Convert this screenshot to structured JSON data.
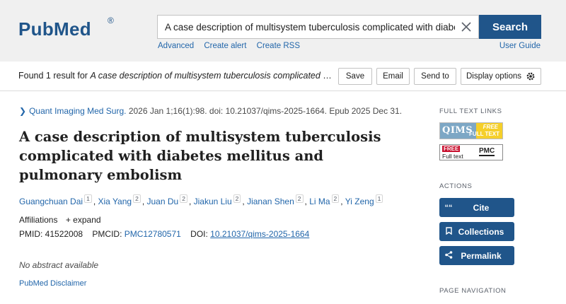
{
  "header": {
    "logo_text": "PubMed",
    "logo_reg": "®",
    "search_value": "A case description of multisystem tuberculosis complicated with diabetes mellitus and pulmonary embolism",
    "search_button": "Search",
    "links": [
      "Advanced",
      "Create alert",
      "Create RSS"
    ],
    "user_guide": "User Guide"
  },
  "result_bar": {
    "found_prefix": "Found 1 result for ",
    "found_query": "A case description of multisystem tuberculosis complicated with diabetes mellitus and pulmonary embolism",
    "save": "Save",
    "email": "Email",
    "send_to": "Send to",
    "display_options": "Display options"
  },
  "article": {
    "journal": "Quant Imaging Med Surg.",
    "citation": " 2026 Jan 1;16(1):98. doi: 10.21037/qims-2025-1664. Epub 2025 Dec 31.",
    "title": "A case description of multisystem tuberculosis complicated with diabetes mellitus and pulmonary embolism",
    "authors": [
      {
        "name": "Guangchuan Dai",
        "aff": "1"
      },
      {
        "name": "Xia Yang",
        "aff": "2"
      },
      {
        "name": "Juan Du",
        "aff": "2"
      },
      {
        "name": "Jiakun Liu",
        "aff": "2"
      },
      {
        "name": "Jianan Shen",
        "aff": "2"
      },
      {
        "name": "Li Ma",
        "aff": "2"
      },
      {
        "name": "Yi Zeng",
        "aff": "1"
      }
    ],
    "affiliations_label": "Affiliations",
    "expand_label": "+ expand",
    "pmid_label": "PMID: 41522008",
    "pmcid_label": "PMCID: ",
    "pmcid": "PMC12780571",
    "doi_label": "DOI: ",
    "doi": "10.21037/qims-2025-1664",
    "no_abstract": "No abstract available",
    "disclaimer": "PubMed Disclaimer"
  },
  "sidebar": {
    "full_text_links": "FULL TEXT LINKS",
    "qims_text": "QIMS",
    "qims_free": "FREE",
    "qims_full": "FULL TEXT",
    "pmc_free": "FREE",
    "pmc_fulltext": "Full text",
    "pmc_label": "PMC",
    "actions": "ACTIONS",
    "cite": "Cite",
    "collections": "Collections",
    "permalink": "Permalink",
    "page_navigation": "PAGE NAVIGATION"
  },
  "colors": {
    "brand": "#20558a",
    "link": "#2266aa"
  }
}
